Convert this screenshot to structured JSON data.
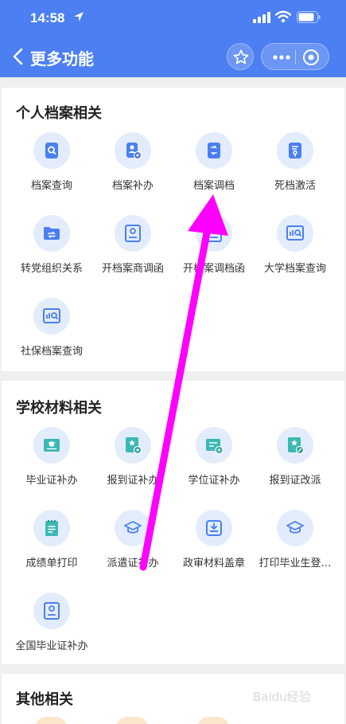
{
  "status_bar": {
    "time": "14:58"
  },
  "nav": {
    "title": "更多功能"
  },
  "sections": {
    "personal": {
      "title": "个人档案相关",
      "items": [
        {
          "label": "档案查询",
          "icon": "search-doc-icon"
        },
        {
          "label": "档案补办",
          "icon": "person-doc-icon"
        },
        {
          "label": "档案调档",
          "icon": "transfer-doc-icon"
        },
        {
          "label": "死档激活",
          "icon": "key-doc-icon"
        },
        {
          "label": "转党组织关系",
          "icon": "folder-transfer-icon"
        },
        {
          "label": "开档案商调函",
          "icon": "portrait-doc-icon"
        },
        {
          "label": "开档案调档函",
          "icon": "portrait-doc-icon"
        },
        {
          "label": "大学档案查询",
          "icon": "chart-search-icon"
        },
        {
          "label": "社保档案查询",
          "icon": "chart-search-icon"
        }
      ]
    },
    "school": {
      "title": "学校材料相关",
      "items": [
        {
          "label": "毕业证补办",
          "icon": "graduation-card-icon"
        },
        {
          "label": "报到证补办",
          "icon": "star-card-icon"
        },
        {
          "label": "学位证补办",
          "icon": "degree-card-icon"
        },
        {
          "label": "报到证改派",
          "icon": "star-edit-card-icon"
        },
        {
          "label": "成绩单打印",
          "icon": "transcript-icon"
        },
        {
          "label": "派遣证补办",
          "icon": "graduation-cap-icon"
        },
        {
          "label": "政审材料盖章",
          "icon": "stamp-icon"
        },
        {
          "label": "打印毕业生登…",
          "icon": "graduation-cap-icon"
        },
        {
          "label": "全国毕业证补办",
          "icon": "portrait-doc-icon"
        }
      ]
    },
    "other": {
      "title": "其他相关"
    }
  },
  "watermark": "Baidu经验",
  "colors": {
    "header": "#4b7ff2",
    "icon_bg": "#e3ecfb",
    "icon_blue": "#4a80ef",
    "icon_teal": "#3ab9b2",
    "arrow": "#ff00ff"
  }
}
